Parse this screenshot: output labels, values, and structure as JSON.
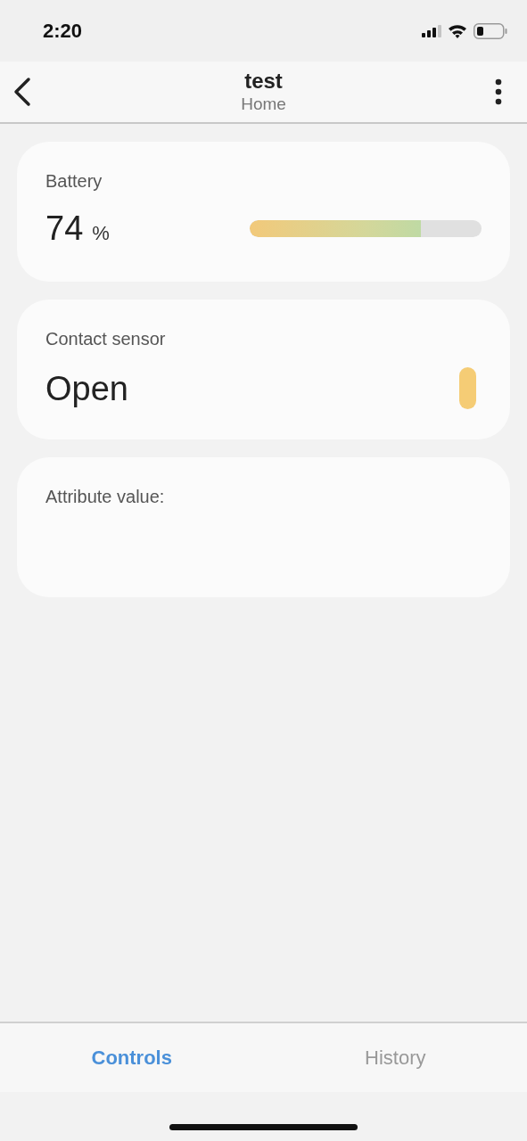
{
  "status_bar": {
    "time": "2:20"
  },
  "header": {
    "title": "test",
    "subtitle": "Home"
  },
  "cards": [
    {
      "kind": "level",
      "label": "Battery",
      "value": "74",
      "unit": "%",
      "level": 0.74
    },
    {
      "kind": "status",
      "label": "Contact sensor",
      "value": "Open"
    },
    {
      "kind": "text",
      "label": "Attribute value:"
    }
  ],
  "tabs": [
    {
      "label": "Controls",
      "selected": true
    },
    {
      "label": "History",
      "selected": false
    }
  ]
}
